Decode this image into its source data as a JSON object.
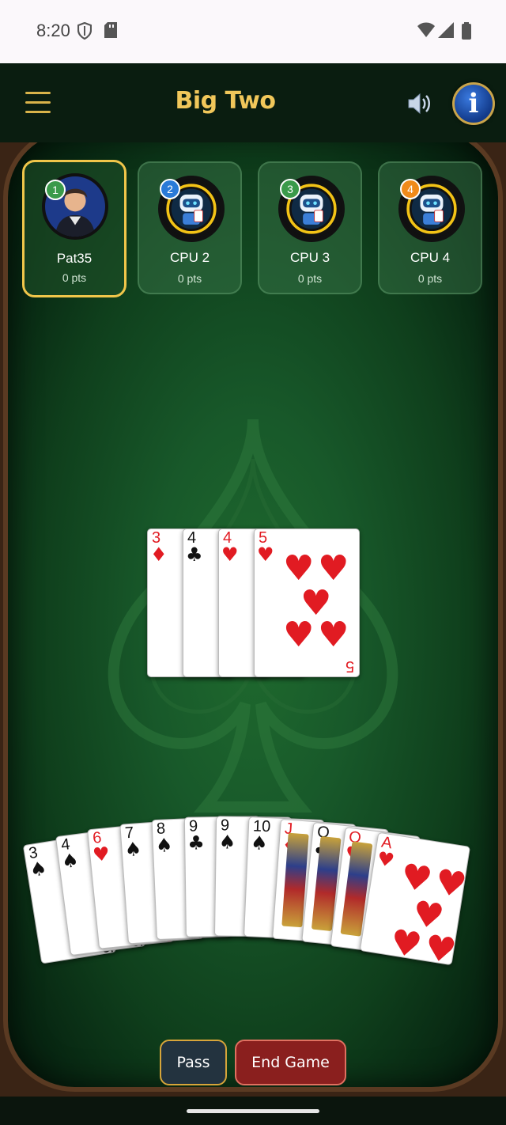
{
  "status_bar": {
    "time": "8:20"
  },
  "header": {
    "title": "Big Two"
  },
  "colors": {
    "gold": "#f1c75a",
    "felt": "#18592a",
    "pass": "#23333f",
    "end_game": "#8a1f1e"
  },
  "players": [
    {
      "seat": "1",
      "name": "Pat35",
      "points": "0 pts",
      "badge_color": "#3a9a4a",
      "active": true
    },
    {
      "seat": "2",
      "name": "CPU 2",
      "points": "0 pts",
      "badge_color": "#2a7ad8"
    },
    {
      "seat": "3",
      "name": "CPU 3",
      "points": "0 pts",
      "badge_color": "#3a9a4a"
    },
    {
      "seat": "4",
      "name": "CPU 4",
      "points": "0 pts",
      "badge_color": "#f08a1a"
    }
  ],
  "played_cards": [
    {
      "rank": "3",
      "suit": "♦",
      "color": "red"
    },
    {
      "rank": "4",
      "suit": "♣",
      "color": "black"
    },
    {
      "rank": "4",
      "suit": "♥",
      "color": "red"
    },
    {
      "rank": "5",
      "suit": "♥",
      "color": "red"
    }
  ],
  "hand": [
    {
      "rank": "3",
      "suit": "♠",
      "color": "black"
    },
    {
      "rank": "4",
      "suit": "♠",
      "color": "black"
    },
    {
      "rank": "6",
      "suit": "♥",
      "color": "red"
    },
    {
      "rank": "7",
      "suit": "♠",
      "color": "black"
    },
    {
      "rank": "8",
      "suit": "♠",
      "color": "black"
    },
    {
      "rank": "9",
      "suit": "♣",
      "color": "black"
    },
    {
      "rank": "9",
      "suit": "♠",
      "color": "black"
    },
    {
      "rank": "10",
      "suit": "♠",
      "color": "black"
    },
    {
      "rank": "J",
      "suit": "♦",
      "color": "red"
    },
    {
      "rank": "Q",
      "suit": "♣",
      "color": "black"
    },
    {
      "rank": "Q",
      "suit": "♥",
      "color": "red"
    },
    {
      "rank": "A",
      "suit": "♥",
      "color": "red"
    }
  ],
  "actions": {
    "pass_label": "Pass",
    "end_game_label": "End Game"
  }
}
